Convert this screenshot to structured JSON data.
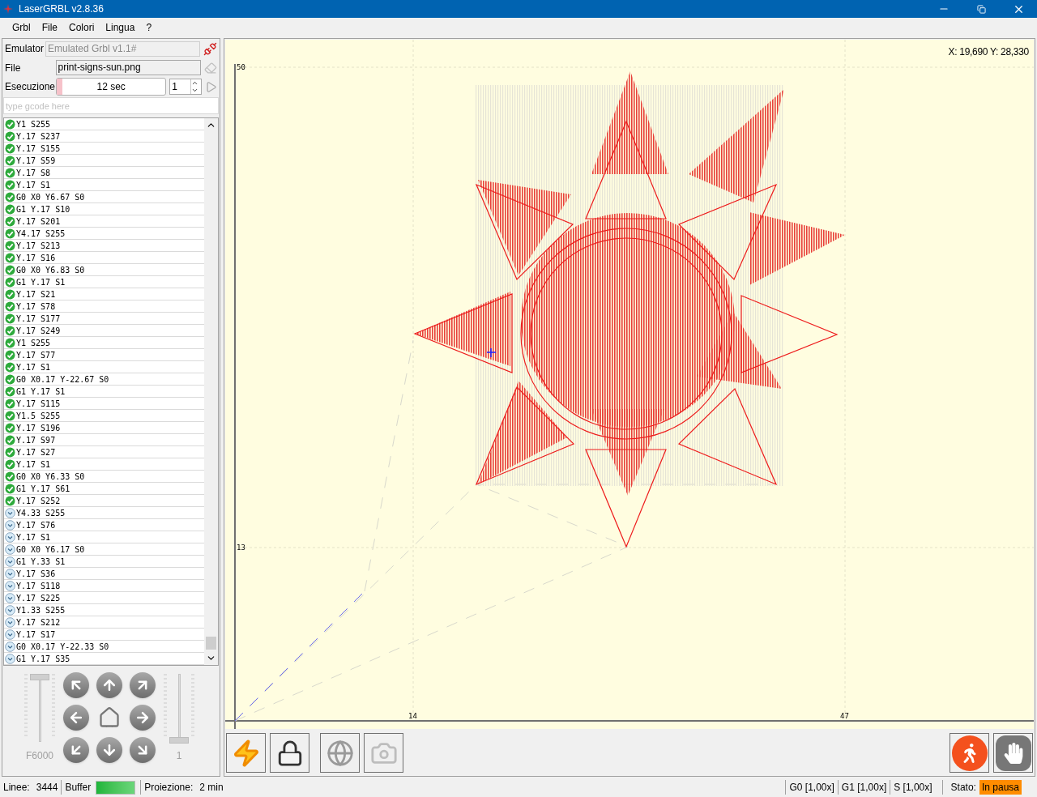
{
  "window": {
    "title": "LaserGRBL v2.8.36"
  },
  "menu": [
    "Grbl",
    "File",
    "Colori",
    "Lingua",
    "?"
  ],
  "connection": {
    "label": "Emulator",
    "value": "Emulated Grbl v1.1#"
  },
  "file": {
    "label": "File",
    "value": "print-signs-sun.png"
  },
  "execution": {
    "label": "Esecuzione",
    "level": 0.05,
    "reading": "12 sec",
    "copies": "1"
  },
  "gcode_input": {
    "placeholder": "type gcode here"
  },
  "gcode_lines": [
    {
      "text": "Y1 S255",
      "done": true
    },
    {
      "text": "Y.17 S237",
      "done": true
    },
    {
      "text": "Y.17 S155",
      "done": true
    },
    {
      "text": "Y.17 S59",
      "done": true
    },
    {
      "text": "Y.17 S8",
      "done": true
    },
    {
      "text": "Y.17 S1",
      "done": true
    },
    {
      "text": "G0 X0 Y6.67 S0",
      "done": true
    },
    {
      "text": "G1 Y.17 S10",
      "done": true
    },
    {
      "text": "Y.17 S201",
      "done": true
    },
    {
      "text": "Y4.17 S255",
      "done": true
    },
    {
      "text": "Y.17 S213",
      "done": true
    },
    {
      "text": "Y.17 S16",
      "done": true
    },
    {
      "text": "G0 X0 Y6.83 S0",
      "done": true
    },
    {
      "text": "G1 Y.17 S1",
      "done": true
    },
    {
      "text": "Y.17 S21",
      "done": true
    },
    {
      "text": "Y.17 S78",
      "done": true
    },
    {
      "text": "Y.17 S177",
      "done": true
    },
    {
      "text": "Y.17 S249",
      "done": true
    },
    {
      "text": "Y1 S255",
      "done": true
    },
    {
      "text": "Y.17 S77",
      "done": true
    },
    {
      "text": "Y.17 S1",
      "done": true
    },
    {
      "text": "G0 X0.17 Y-22.67 S0",
      "done": true
    },
    {
      "text": "G1 Y.17 S1",
      "done": true
    },
    {
      "text": "Y.17 S115",
      "done": true
    },
    {
      "text": "Y1.5 S255",
      "done": true
    },
    {
      "text": "Y.17 S196",
      "done": true
    },
    {
      "text": "Y.17 S97",
      "done": true
    },
    {
      "text": "Y.17 S27",
      "done": true
    },
    {
      "text": "Y.17 S1",
      "done": true
    },
    {
      "text": "G0 X0 Y6.33 S0",
      "done": true
    },
    {
      "text": "G1 Y.17 S61",
      "done": true
    },
    {
      "text": "Y.17 S252",
      "done": true
    },
    {
      "text": "Y4.33 S255",
      "done": false
    },
    {
      "text": "Y.17 S76",
      "done": false
    },
    {
      "text": "Y.17 S1",
      "done": false
    },
    {
      "text": "G0 X0 Y6.17 S0",
      "done": false
    },
    {
      "text": "G1 Y.33 S1",
      "done": false
    },
    {
      "text": "Y.17 S36",
      "done": false
    },
    {
      "text": "Y.17 S118",
      "done": false
    },
    {
      "text": "Y.17 S225",
      "done": false
    },
    {
      "text": "Y1.33 S255",
      "done": false
    },
    {
      "text": "Y.17 S212",
      "done": false
    },
    {
      "text": "Y.17 S17",
      "done": false
    },
    {
      "text": "G0 X0.17 Y-22.33 S0",
      "done": false
    },
    {
      "text": "G1 Y.17 S35",
      "done": false
    }
  ],
  "jog": {
    "speed": {
      "label": "F6000",
      "level": 1
    },
    "step": {
      "label": "1",
      "level": 0
    }
  },
  "preview": {
    "coordinates": "X: 19,690 Y: 28,330",
    "y_labels": [
      "50",
      "13"
    ],
    "x_labels": [
      "14",
      "47"
    ]
  },
  "status_bar": {
    "lines_label": "Linee:",
    "lines": "3444",
    "buffer": {
      "label": "Buffer",
      "level": 1
    },
    "projection_label": "Proiezione:",
    "projection": "2 min",
    "overrides": [
      "G0 [1,00x]",
      "G1 [1,00x]",
      "S [1,00x]"
    ],
    "state_label": "Stato:",
    "state": "In pausa"
  }
}
